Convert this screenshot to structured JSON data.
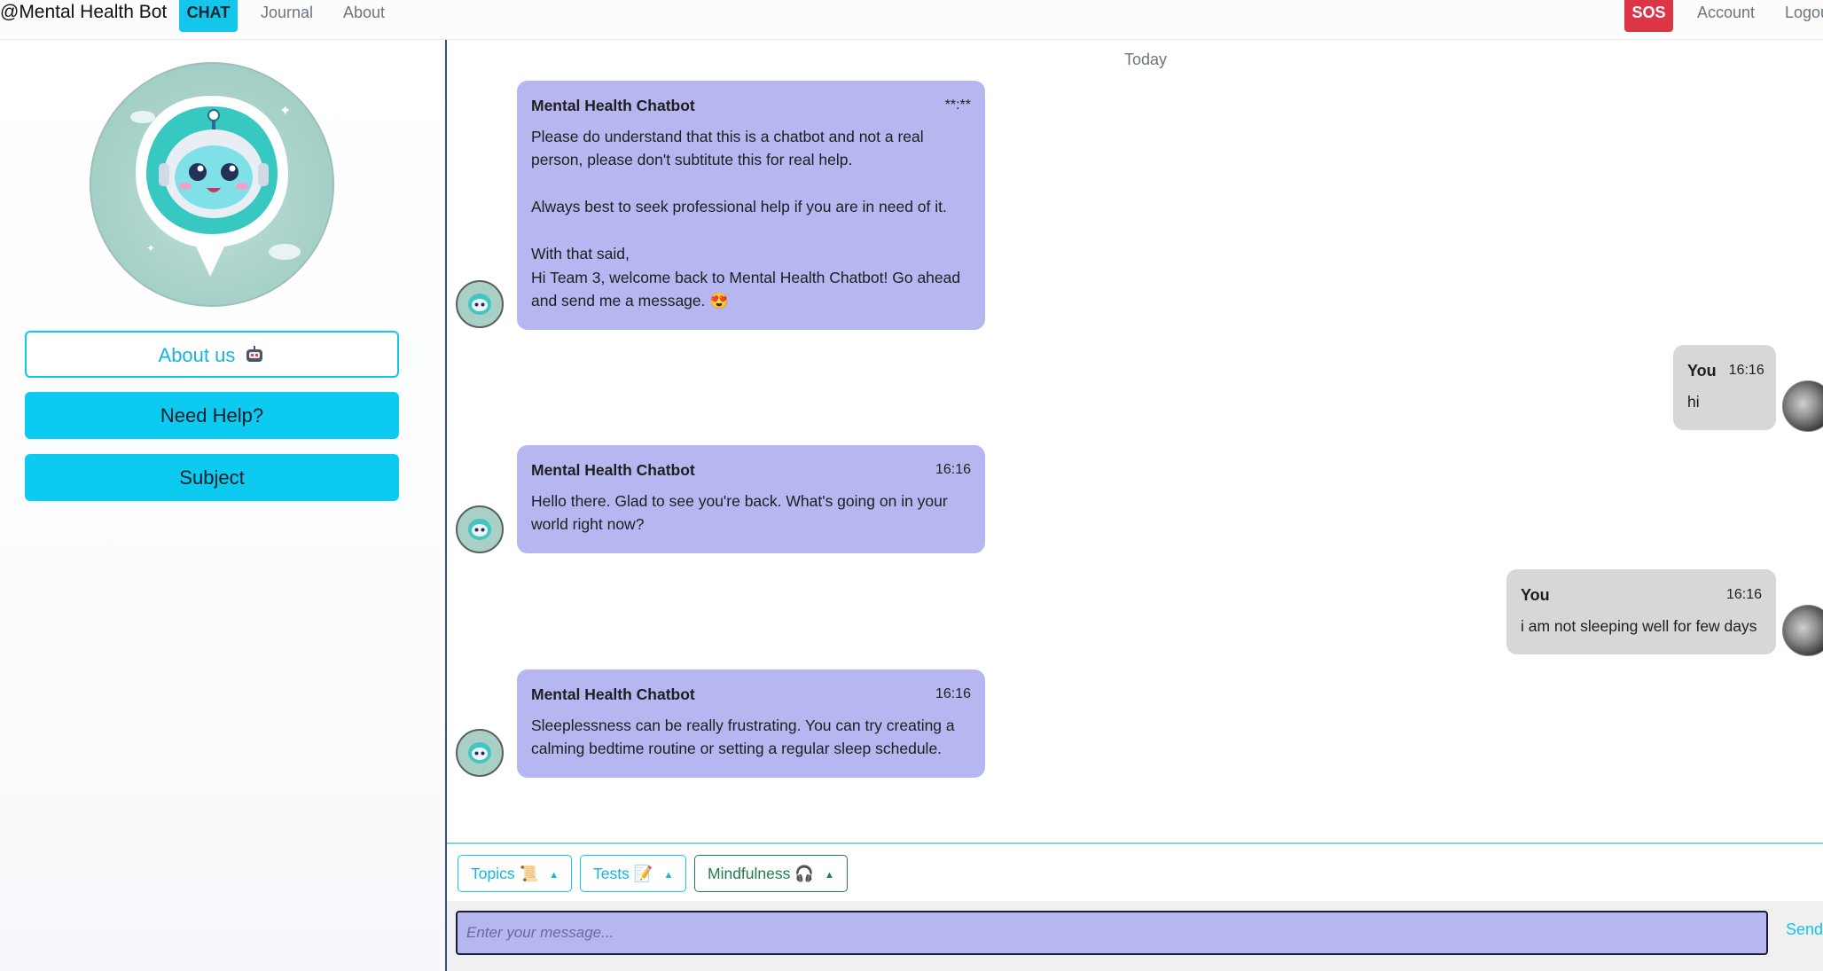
{
  "navbar": {
    "brand": "@Mental Health Bot",
    "chat_label": "CHAT",
    "journal_label": "Journal",
    "about_label": "About",
    "sos_label": "SOS",
    "account_label": "Account",
    "logout_label": "Logou"
  },
  "sidebar": {
    "about_us_label": "About us",
    "need_help_label": "Need Help?",
    "subject_label": "Subject"
  },
  "chat": {
    "day_label": "Today",
    "messages": [
      {
        "sender": "Mental Health Chatbot",
        "time": "**:**",
        "lines": [
          "Please do understand that this is a chatbot and not a real",
          "person, please don't subtitute this for real help.",
          "",
          "Always best to seek professional help if you are in need of it.",
          "",
          "With that said,",
          "Hi Team 3, welcome back to Mental Health Chatbot! Go ahead",
          "and send me a message. 😍"
        ]
      },
      {
        "sender": "You",
        "time": "16:16",
        "lines": [
          "hi"
        ]
      },
      {
        "sender": "Mental Health Chatbot",
        "time": "16:16",
        "lines": [
          "Hello there. Glad to see you're back. What's going on in your",
          "world right now?"
        ]
      },
      {
        "sender": "You",
        "time": "16:16",
        "lines": [
          "i am not sleeping well for few days"
        ]
      },
      {
        "sender": "Mental Health Chatbot",
        "time": "16:16",
        "lines": [
          "Sleeplessness can be really frustrating. You can try creating a",
          "calming bedtime routine or setting a regular sleep schedule."
        ]
      }
    ]
  },
  "toolbar": {
    "topics_label": "Topics 📜",
    "tests_label": "Tests 📝",
    "mindfulness_label": "Mindfulness 🎧"
  },
  "input": {
    "placeholder": "Enter your message...",
    "send_label": "Send"
  },
  "colors": {
    "accent": "#0dcaf0",
    "bot_bubble": "#b6b7f1",
    "user_bubble": "#d7d7d7",
    "sos": "#dc3545"
  }
}
